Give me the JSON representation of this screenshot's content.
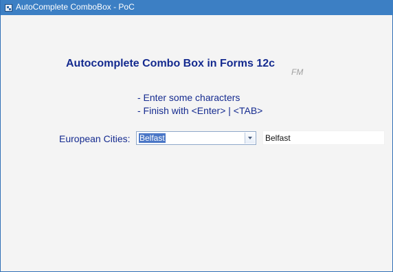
{
  "window": {
    "title": "AutoComplete ComboBox - PoC",
    "app_icon": "oracle-forms-icon"
  },
  "form": {
    "heading": "Autocomplete Combo Box in Forms 12c",
    "author_mark": "FM",
    "instructions": [
      "- Enter some characters",
      "- Finish with <Enter> | <TAB>"
    ],
    "city_label": "European Cities:",
    "combo_value": "Belfast",
    "result_value": "Belfast"
  },
  "icons": {
    "combo_arrow": "chevron-down-icon"
  },
  "colors": {
    "titlebar": "#3c7fc4",
    "label_text": "#142a8f",
    "selection": "#4a76c6",
    "background": "#f4f4f4"
  }
}
